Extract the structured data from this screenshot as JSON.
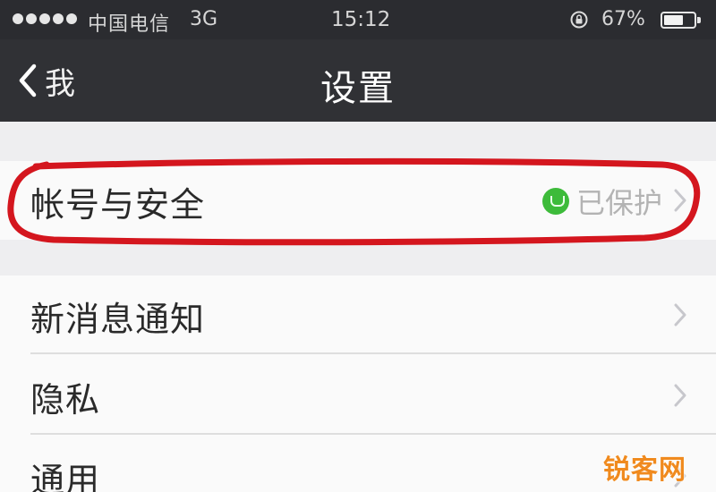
{
  "status_bar": {
    "signal_dots": 5,
    "carrier": "中国电信",
    "network": "3G",
    "time": "15:12",
    "battery_percent_text": "67%",
    "battery_level": 0.67,
    "icons": [
      "signal-dots-icon",
      "rotation-lock-icon",
      "battery-icon"
    ]
  },
  "nav": {
    "back_label": "我",
    "title": "设置"
  },
  "settings": {
    "account": {
      "label": "帐号与安全",
      "status": "已保护",
      "status_color": "#3dbb3a"
    },
    "items": [
      {
        "label": "新消息通知"
      },
      {
        "label": "隐私"
      },
      {
        "label": "通用"
      }
    ]
  },
  "annotation": {
    "highlight_color": "#d4161e"
  },
  "watermark": {
    "text": "锐客网"
  }
}
